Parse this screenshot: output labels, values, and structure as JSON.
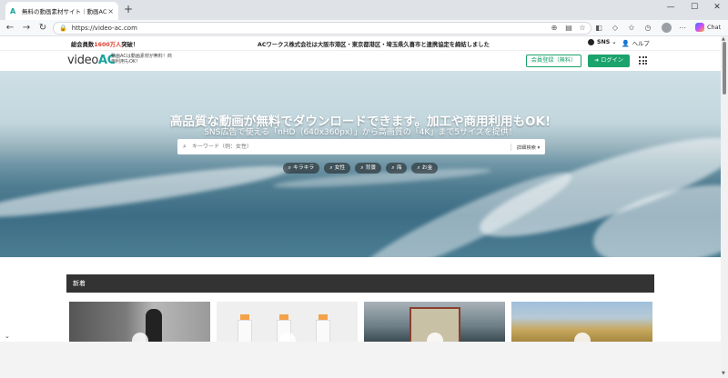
{
  "browser": {
    "tab_title": "無料の動画素材サイト｜動画AC",
    "tab_close": "×",
    "new_tab": "+",
    "url": "https://video-ac.com",
    "copilot_label": "Chat",
    "window_min": "—",
    "window_max": "☐",
    "window_close": "✕"
  },
  "infobar": {
    "count_prefix": "総会員数",
    "count_number": "1600万人",
    "count_suffix": "突破！",
    "notice": "ACワークス株式会社は大阪市港区・東京都港区・埼玉県久喜市と連携協定を締結しました",
    "sns_label": "SNS",
    "help_label": "ヘルプ"
  },
  "header": {
    "logo_video": "video",
    "logo_ac": "AC",
    "tagline": "動画ACは動画素材が無料！商用利用もOK！",
    "signup_label": "会員登録（無料）",
    "login_label": "ログイン"
  },
  "hero": {
    "title": "高品質な動画が無料でダウンロードできます。加工や商用利用もOK!",
    "subtitle": "SNS広告で使える「nHD（640x360px）」から高画質の「4K」まで5サイズを提供！",
    "search_placeholder": "キーワード（例：女性）",
    "detail_search": "詳細検索 ▾",
    "tags": [
      "キラキラ",
      "女性",
      "背景",
      "海",
      "お金"
    ]
  },
  "section": {
    "title": "新着"
  },
  "colors": {
    "accent": "#1aa36b",
    "brand": "#1aa39c",
    "count_red": "#e0402f"
  }
}
